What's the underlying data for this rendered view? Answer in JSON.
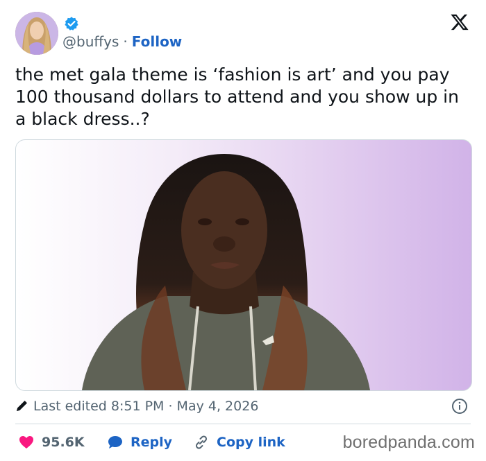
{
  "tweet": {
    "handle": "@buffys",
    "separator": "·",
    "follow_label": "Follow",
    "text": "the met gala theme is ‘fashion is art’ and you pay 100 thousand dollars to attend and you show up in a black dress..?",
    "edited_label": "Last edited 8:51 PM · May 4, 2026",
    "likes": "95.6K",
    "reply_label": "Reply",
    "copy_link_label": "Copy link"
  },
  "icons": {
    "verified": "verified-badge-icon",
    "brand": "x-logo-icon",
    "edit": "pencil-icon",
    "info": "info-icon",
    "like": "heart-icon",
    "reply": "speech-bubble-icon",
    "copy": "link-icon"
  },
  "colors": {
    "accent_blue": "#1d64c4",
    "like_pink": "#f91880",
    "muted_text": "#536471",
    "border": "#cfd9de"
  },
  "watermark": "boredpanda.com"
}
